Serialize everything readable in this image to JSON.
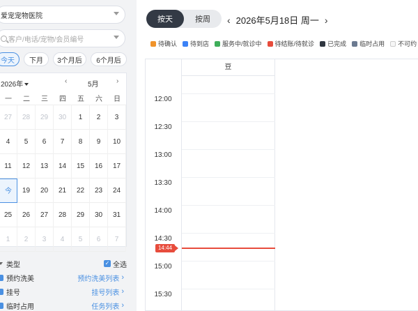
{
  "store": {
    "name": "爱宠宠物医院"
  },
  "search": {
    "placeholder": "客户/电话/宠物/会员编号"
  },
  "quick": [
    "今天",
    "下月",
    "3个月后",
    "6个月后"
  ],
  "calendar": {
    "year": "2026年",
    "month": "5月",
    "weekdays": [
      "一",
      "二",
      "三",
      "四",
      "五",
      "六",
      "日"
    ],
    "weeks": [
      [
        "27",
        "28",
        "29",
        "30",
        "1",
        "2",
        "3"
      ],
      [
        "4",
        "5",
        "6",
        "7",
        "8",
        "9",
        "10"
      ],
      [
        "11",
        "12",
        "13",
        "14",
        "15",
        "16",
        "17"
      ],
      [
        "今",
        "19",
        "20",
        "21",
        "22",
        "23",
        "24"
      ],
      [
        "25",
        "26",
        "27",
        "28",
        "29",
        "30",
        "31"
      ],
      [
        "1",
        "2",
        "3",
        "4",
        "5",
        "6",
        "7"
      ]
    ]
  },
  "types": {
    "header": "类型",
    "select_all": "全选",
    "items": [
      {
        "label": "预约洗美",
        "link": "预约洗美列表"
      },
      {
        "label": "挂号",
        "link": "挂号列表"
      },
      {
        "label": "临时占用",
        "link": "任务列表"
      }
    ]
  },
  "view": {
    "day": "按天",
    "week": "按周"
  },
  "date_title": "2026年5月18日 周一",
  "legend": [
    {
      "label": "待确认",
      "color": "#f0932b"
    },
    {
      "label": "待到店",
      "color": "#3b82f6"
    },
    {
      "label": "服务中/就诊中",
      "color": "#3fae5a"
    },
    {
      "label": "待结账/待就诊",
      "color": "#e74c3c"
    },
    {
      "label": "已完成",
      "color": "#2f3640"
    },
    {
      "label": "临时占用",
      "color": "#6b7a90"
    },
    {
      "label": "不可约",
      "color": "#f7f7f7"
    }
  ],
  "schedule": {
    "column": "豆",
    "times": [
      "12:00",
      "12:30",
      "13:00",
      "13:30",
      "14:00",
      "14:30",
      "15:00",
      "15:30"
    ],
    "now": "14:44"
  }
}
